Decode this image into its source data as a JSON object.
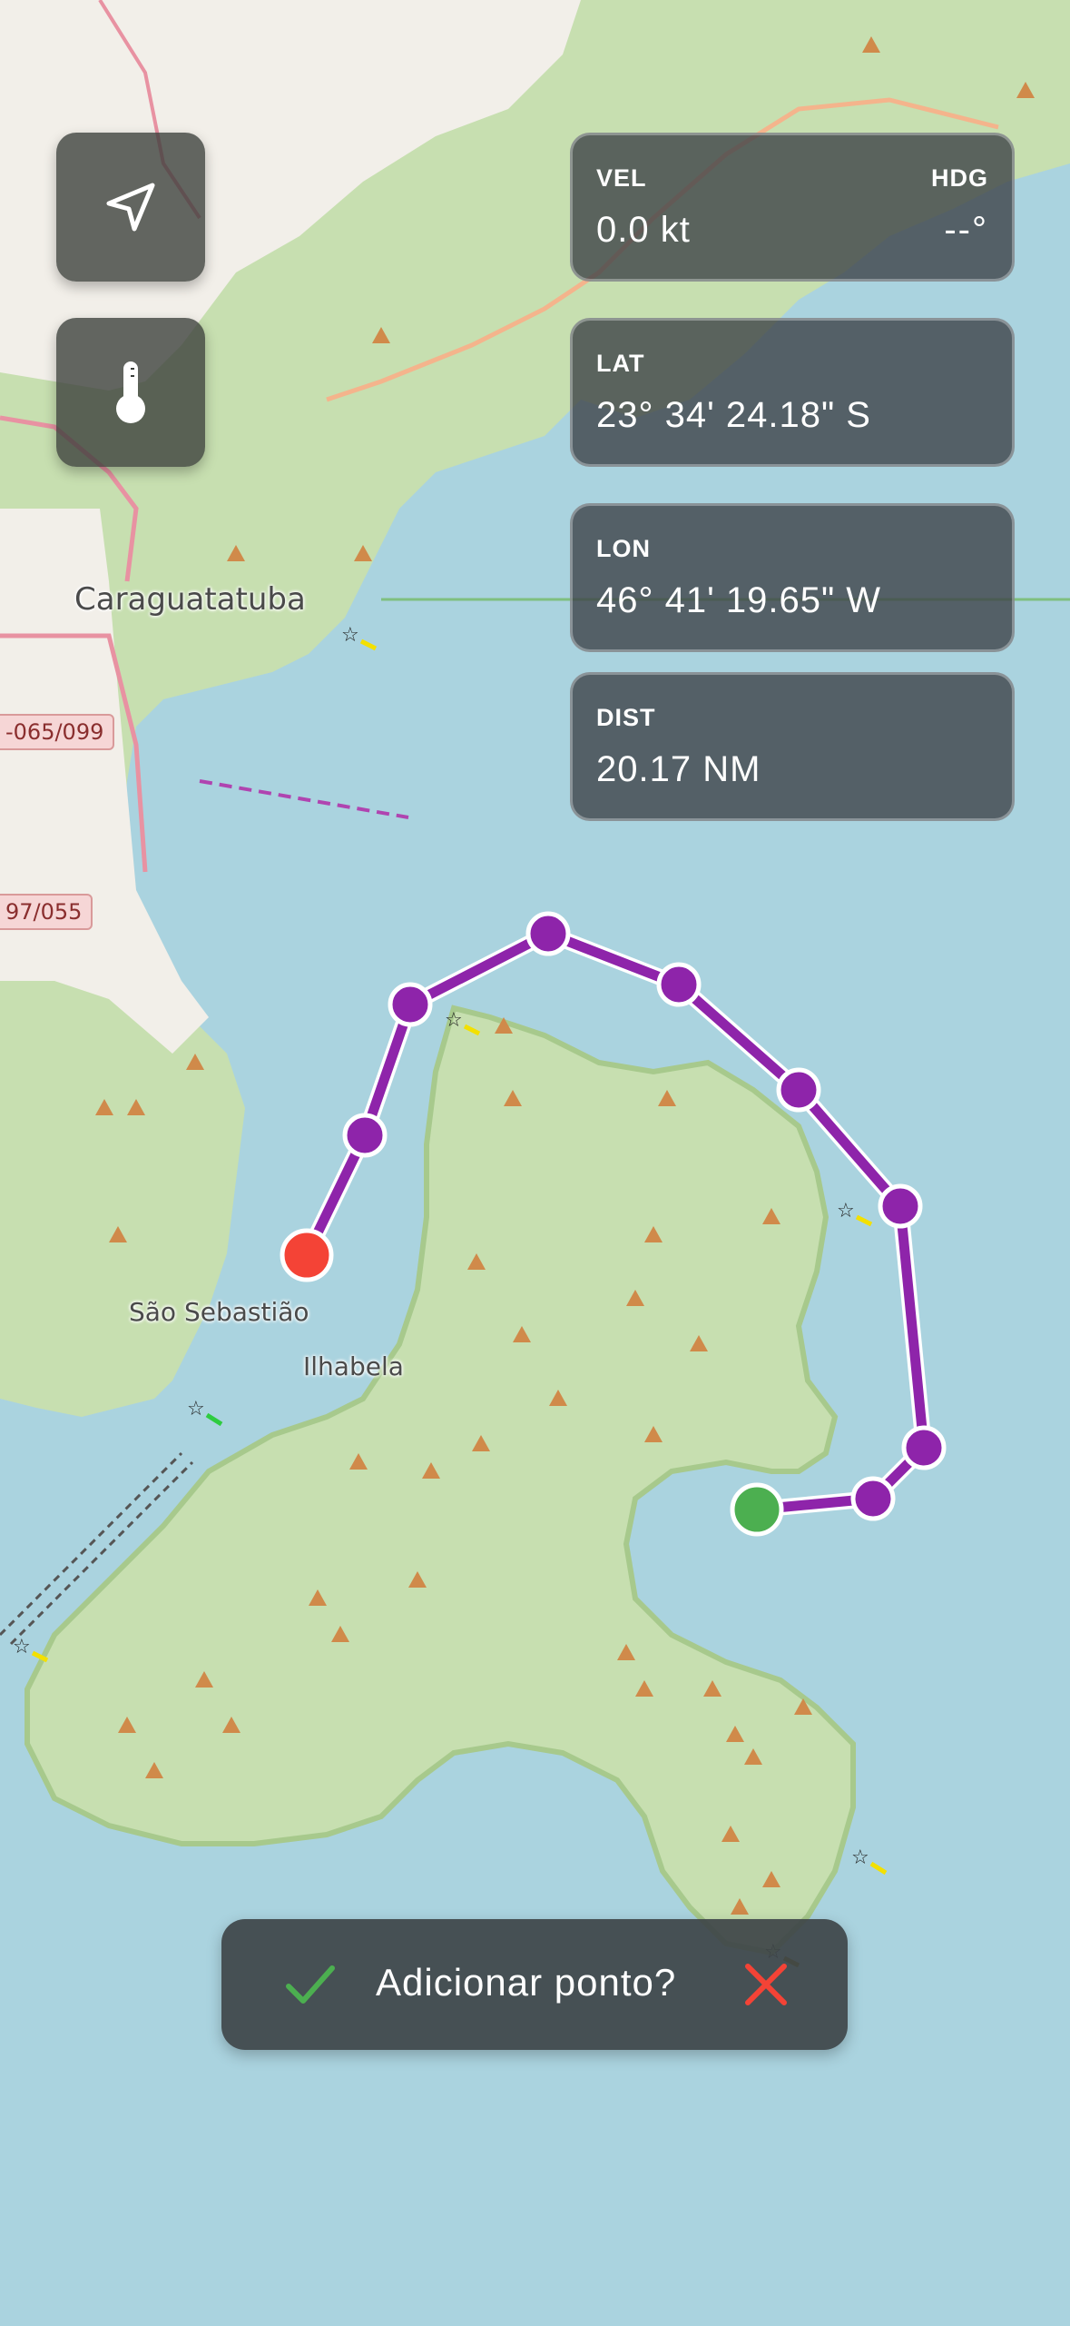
{
  "map": {
    "labels": {
      "caraguatatuba": "Caraguatatuba",
      "sao_sebastiao": "São Sebastião",
      "ilhabela": "Ilhabela",
      "road_1": "-065/099",
      "road_2": "97/055"
    },
    "route_color": "#8e24aa",
    "start_color": "#4caf50",
    "end_color": "#f44336",
    "water_color": "#aad3df",
    "land_color": "#c7dfb0"
  },
  "controls": {
    "navigate_icon": "navigation-arrow-icon",
    "temperature_icon": "thermometer-icon"
  },
  "panels": {
    "vel_label": "VEL",
    "vel_value": "0.0 kt",
    "hdg_label": "HDG",
    "hdg_value": "--°",
    "lat_label": "LAT",
    "lat_value": "23° 34' 24.18\" S",
    "lon_label": "LON",
    "lon_value": "46° 41' 19.65\" W",
    "dist_label": "DIST",
    "dist_value": "20.17 NM"
  },
  "toast": {
    "message": "Adicionar ponto?",
    "confirm_icon": "checkmark-icon",
    "cancel_icon": "close-icon",
    "confirm_color": "#4caf50",
    "cancel_color": "#f44336"
  }
}
